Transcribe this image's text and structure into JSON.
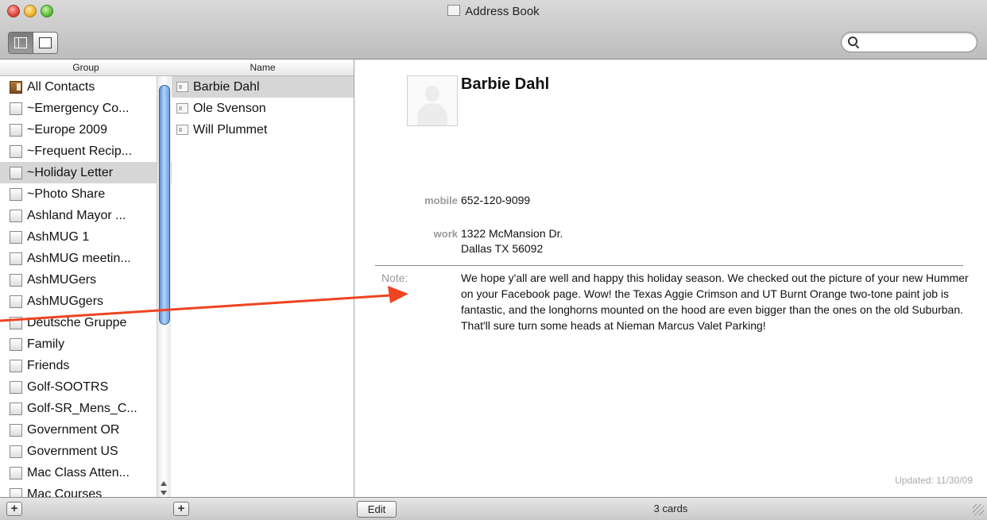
{
  "window": {
    "title": "Address Book"
  },
  "search": {
    "placeholder": ""
  },
  "groups": {
    "header": "Group",
    "items": [
      "All Contacts",
      "~Emergency Co...",
      "~Europe 2009",
      "~Frequent Recip...",
      "~Holiday Letter",
      "~Photo Share",
      "Ashland Mayor ...",
      "AshMUG 1",
      "AshMUG meetin...",
      "AshMUGers",
      "AshMUGgers",
      "Deutsche Gruppe",
      "Family",
      "Friends",
      "Golf-SOOTRS",
      "Golf-SR_Mens_C...",
      "Government OR",
      "Government US",
      "Mac Class Atten...",
      "Mac Courses"
    ],
    "selected_index": 4
  },
  "names": {
    "header": "Name",
    "items": [
      "Barbie Dahl",
      "Ole Svenson",
      "Will Plummet"
    ],
    "selected_index": 0
  },
  "card": {
    "name": "Barbie Dahl",
    "mobile_label": "mobile",
    "mobile": "652-120-9099",
    "work_label": "work",
    "work_line1": "1322 McMansion Dr.",
    "work_line2": "Dallas TX 56092",
    "note_label": "Note:",
    "note": "We hope y'all are well and happy this holiday season. We checked out the picture of your new Hummer on your Facebook page. Wow! the Texas Aggie Crimson and UT Burnt Orange two-tone paint job is fantastic, and the longhorns mounted on the hood are even bigger than the ones on the old Suburban. That'll sure turn some heads at Nieman Marcus Valet Parking!",
    "updated": "Updated: 11/30/09"
  },
  "bottombar": {
    "add_group": "+",
    "add_card": "+",
    "edit": "Edit",
    "count": "3 cards"
  },
  "colors": {
    "annotation_arrow": "#ee4422",
    "selection": "#d6d6d6"
  }
}
